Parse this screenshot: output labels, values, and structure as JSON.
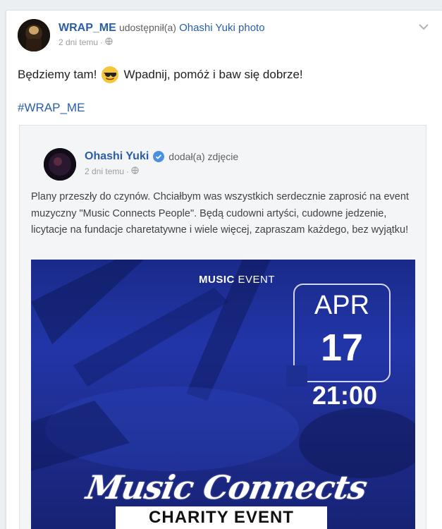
{
  "post": {
    "author": "WRAP_ME",
    "action": "udostępnił(a)",
    "shared_from": "Ohashi Yuki photo",
    "time": "2 dni temu",
    "separator": "·",
    "text_before_emoji": "Będziemy tam!",
    "emoji": "sunglasses-emoji",
    "text_after_emoji": "Wpadnij, pomóż i baw się dobrze!",
    "hashtag": "#WRAP_ME"
  },
  "shared": {
    "author": "Ohashi Yuki",
    "action": "dodał(a) zdjęcie",
    "time": "2 dni temu",
    "separator": "·",
    "text": "Plany przeszły do czynów. Chciałbym was wszystkich serdecznie zaprosić na event muzyczny \"Music Connects People\". Będą cudowni artyści, cudowne jedzenie, licytacje na fundacje charetatywne i wiele więcej, zapraszam każdego, bez wyjątku!"
  },
  "event_image": {
    "label_bold": "MUSIC",
    "label_rest": " EVENT",
    "month": "APR",
    "day": "17",
    "time": "21:00",
    "title": "Music Connects People",
    "subtitle": "CHARITY EVENT"
  },
  "colors": {
    "accent": "#2a5da8",
    "verified": "#4a90e2",
    "card": "#ffffff",
    "page": "#eceff1"
  },
  "icons": [
    "globe-icon",
    "chevron-down-icon",
    "verified-icon",
    "sunglasses-emoji"
  ]
}
